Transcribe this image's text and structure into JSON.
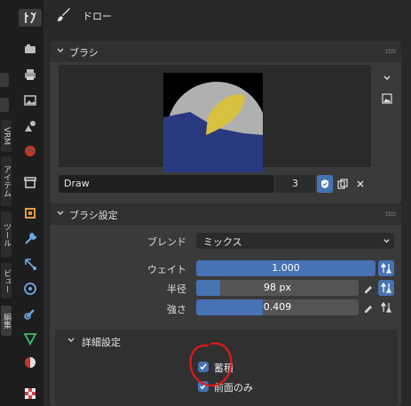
{
  "header": {
    "mode_title": "ドロー"
  },
  "left_tabs": [
    "ビュー",
    "ツール",
    "アイテム",
    "VRM",
    "編集"
  ],
  "brush_panel": {
    "title": "ブラシ",
    "brush_name": "Draw",
    "user_count": "3"
  },
  "brush_settings": {
    "title": "ブラシ設定",
    "blend_label": "ブレンド",
    "blend_value": "ミックス",
    "weight_label": "ウェイト",
    "weight_value": "1.000",
    "weight_fraction": 1.0,
    "radius_label": "半径",
    "radius_value": "98 px",
    "radius_fraction": 0.15,
    "strength_label": "強さ",
    "strength_value": "0.409",
    "strength_fraction": 0.409
  },
  "advanced": {
    "title": "詳細設定",
    "accumulate_label": "蓄積",
    "accumulate_checked": true,
    "front_faces_label": "前面のみ",
    "front_faces_checked": true
  },
  "colors": {
    "accent": "#4772b3",
    "annotation": "#e01818"
  }
}
